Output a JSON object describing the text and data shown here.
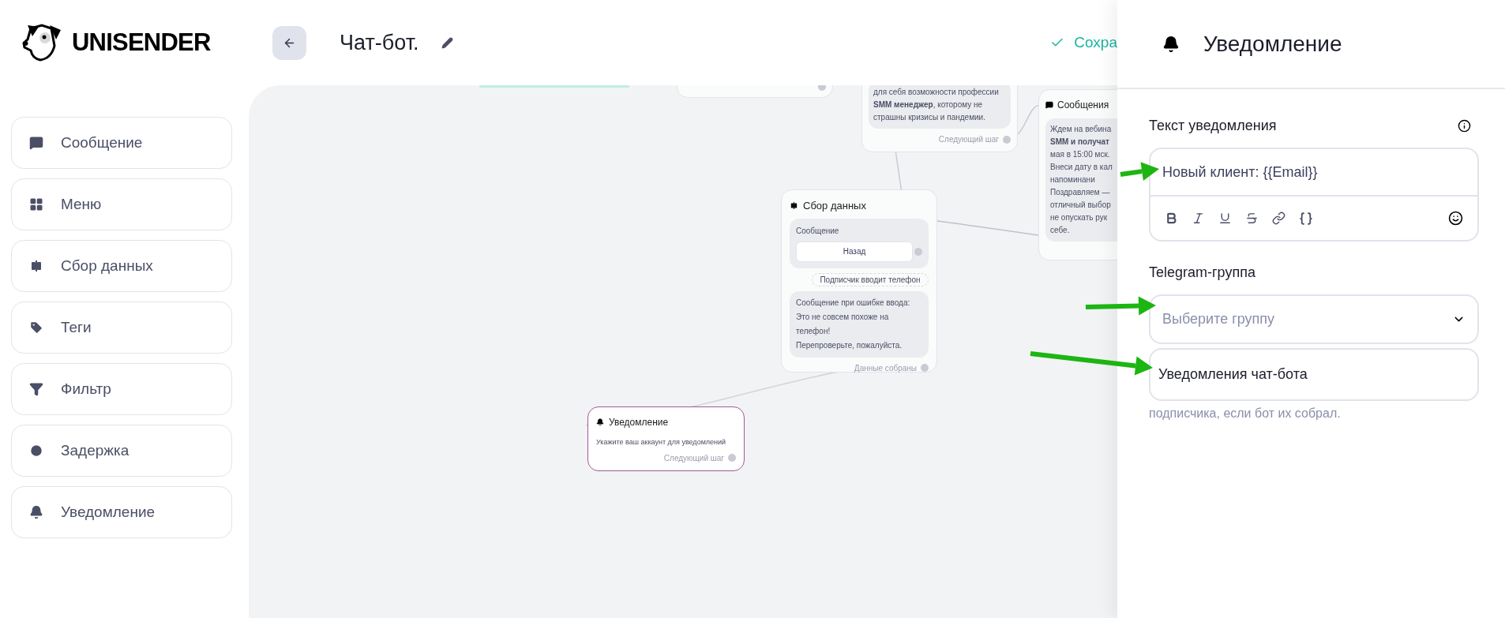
{
  "logo": {
    "text": "UNISENDER"
  },
  "header": {
    "title": "Чат-бот.",
    "save_status": "Сохра"
  },
  "palette": [
    {
      "label": "Сообщение",
      "kind": "message"
    },
    {
      "label": "Меню",
      "kind": "menu"
    },
    {
      "label": "Сбор данных",
      "kind": "collect"
    },
    {
      "label": "Теги",
      "kind": "tags"
    },
    {
      "label": "Фильтр",
      "kind": "filter"
    },
    {
      "label": "Задержка",
      "kind": "delay"
    },
    {
      "label": "Уведомление",
      "kind": "notification"
    }
  ],
  "canvas": {
    "nodes": [
      {
        "kind": "stub",
        "selected": false
      },
      {
        "kind": "message",
        "selected": false,
        "lines": [
          "для себя возможности профессии",
          "**SMM менеджер**, которому не",
          "страшны кризисы и пандемии."
        ],
        "footer": "Следующий шаг"
      },
      {
        "kind": "message",
        "selected": false,
        "title": "Сообщения",
        "lines": [
          "Ждем на вебина",
          "**SMM и получат**",
          "мая в 15:00 мск.",
          "Внеси дату в кал",
          "напоминани",
          "Поздравляем —",
          "отличный выбор",
          "не опускать рук",
          "себе."
        ]
      },
      {
        "kind": "collect",
        "selected": false,
        "title": "Сбор данных",
        "message_label": "Сообщение",
        "button": "Назад",
        "input_hint": "Подписчик вводит телефон",
        "error_lines": [
          "Сообщение при ошибке ввода:",
          "Это не совсем похоже на телефон!",
          "Перепроверьте, пожалуйста."
        ],
        "footer": "Данные собраны"
      },
      {
        "kind": "notification",
        "selected": true,
        "title": "Уведомление",
        "text": "Укажите ваш аккаунт для уведомлений",
        "footer": "Следующий шаг"
      }
    ]
  },
  "panel": {
    "title": "Уведомление",
    "text_label": "Текст уведомления",
    "text_value": "Новый клиент: {{Email}}",
    "group_label": "Telegram-группа",
    "group_placeholder": "Выберите группу",
    "dropdown_options": [
      "Уведомления чат-бота"
    ],
    "hint": "подписчика, если бот их собрал."
  }
}
